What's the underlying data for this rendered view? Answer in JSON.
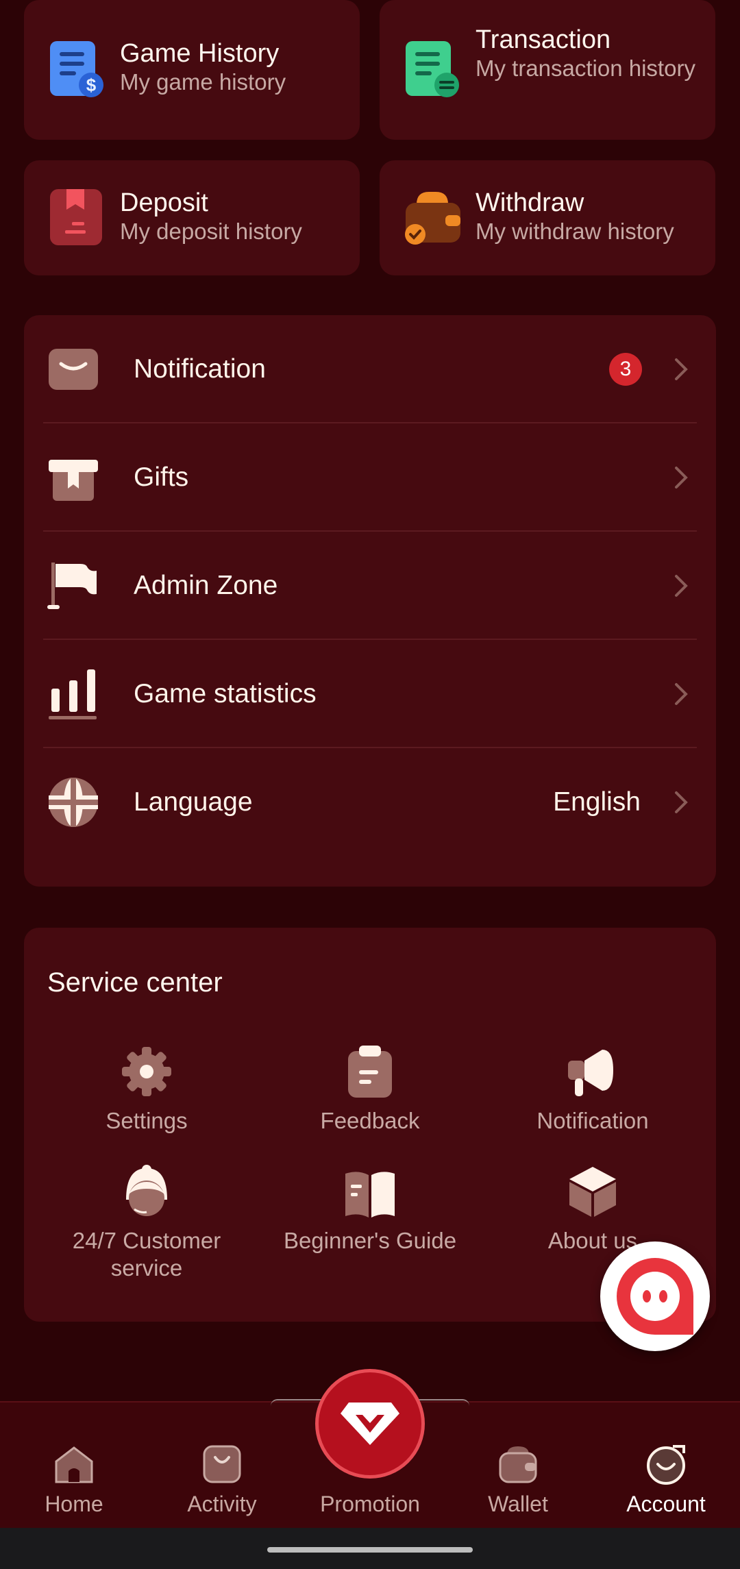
{
  "history_cards": [
    {
      "title": "Game History",
      "subtitle": "My game history",
      "icon": "game-history-icon"
    },
    {
      "title": "Transaction",
      "subtitle": "My transaction history",
      "icon": "transaction-icon"
    },
    {
      "title": "Deposit",
      "subtitle": "My deposit history",
      "icon": "deposit-icon"
    },
    {
      "title": "Withdraw",
      "subtitle": "My withdraw history",
      "icon": "withdraw-icon"
    }
  ],
  "menu": {
    "notification": {
      "label": "Notification",
      "badge": "3"
    },
    "gifts": {
      "label": "Gifts"
    },
    "admin_zone": {
      "label": "Admin Zone"
    },
    "game_statistics": {
      "label": "Game statistics"
    },
    "language": {
      "label": "Language",
      "value": "English"
    }
  },
  "service_center": {
    "title": "Service center",
    "items": [
      {
        "label": "Settings",
        "icon": "gear-icon"
      },
      {
        "label": "Feedback",
        "icon": "clipboard-icon"
      },
      {
        "label": "Notification",
        "icon": "megaphone-icon"
      },
      {
        "label": "24/7 Customer service",
        "icon": "customer-service-icon"
      },
      {
        "label": "Beginner's Guide",
        "icon": "book-icon"
      },
      {
        "label": "About us",
        "icon": "box-icon"
      }
    ]
  },
  "bottom_nav": {
    "home": "Home",
    "activity": "Activity",
    "promotion": "Promotion",
    "wallet": "Wallet",
    "account": "Account"
  },
  "colors": {
    "background": "#2c0306",
    "card": "#460a10",
    "accent": "#d4262d"
  }
}
